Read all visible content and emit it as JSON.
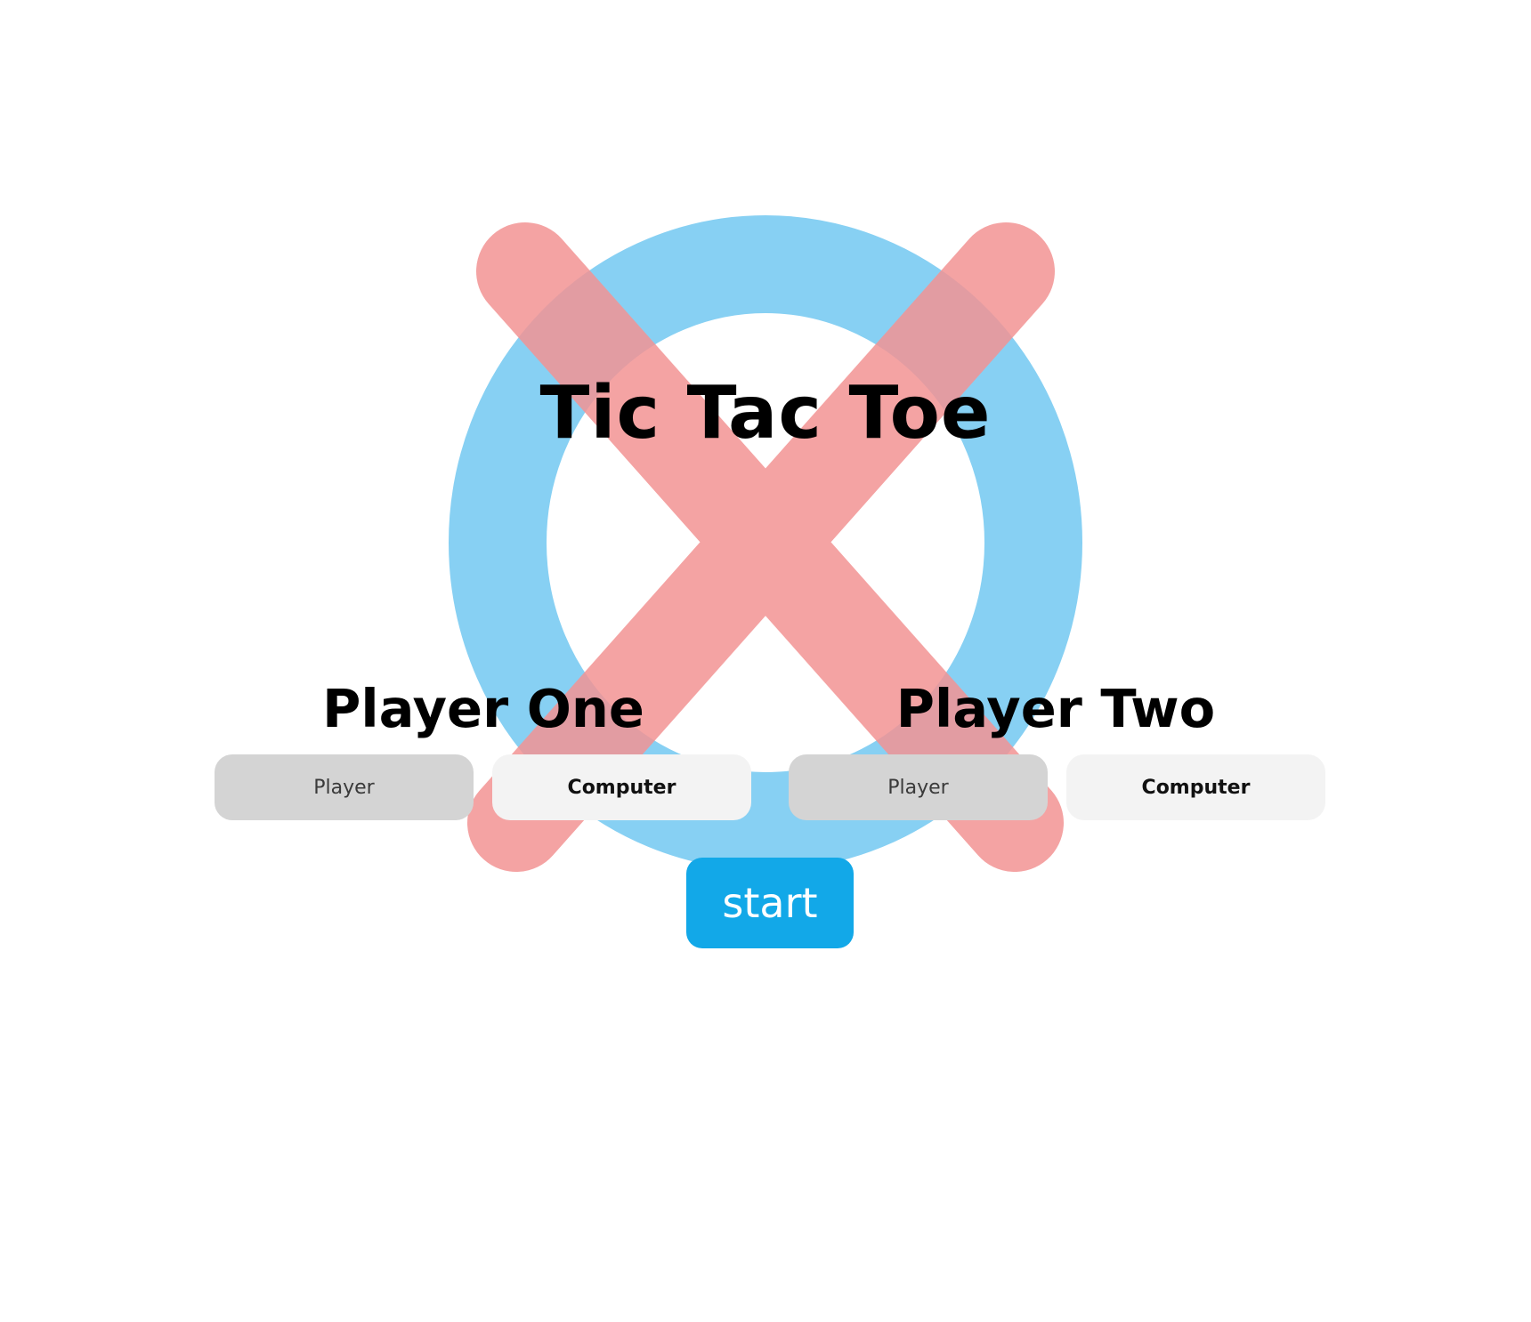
{
  "title": "Tic Tac Toe",
  "player_one": {
    "heading": "Player One",
    "options": [
      "Player",
      "Computer"
    ],
    "selected": "Player"
  },
  "player_two": {
    "heading": "Player Two",
    "options": [
      "Player",
      "Computer"
    ],
    "selected": "Player"
  },
  "start_label": "start",
  "icons": {
    "background_o": "o-mark-icon",
    "background_x": "x-mark-icon"
  },
  "colors": {
    "o_mark": "#87d0f3",
    "x_mark": "#f39494",
    "start_button": "#12a8e8",
    "option_selected": "#d4d4d4",
    "option_unselected": "#f3f3f3"
  }
}
